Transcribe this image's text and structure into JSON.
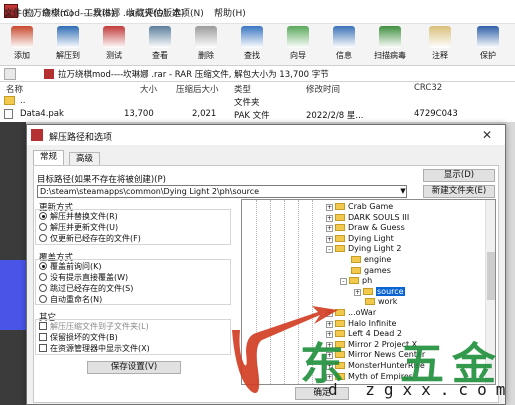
{
  "window": {
    "title": "拉万绕棋mod----坎琳娜 .rar (评估版本)"
  },
  "menu": [
    "文件(F)",
    "命令(C)",
    "工具(S)",
    "收藏夹(O)",
    "选项(N)",
    "帮助(H)"
  ],
  "toolbar": [
    {
      "label": "添加",
      "icon": "add-books-icon",
      "color": "#c84a2e"
    },
    {
      "label": "解压到",
      "icon": "extract-to-icon",
      "color": "#2f6db5"
    },
    {
      "label": "测试",
      "icon": "test-icon",
      "color": "#c23a3a"
    },
    {
      "label": "查看",
      "icon": "view-icon",
      "color": "#5c7f9c"
    },
    {
      "label": "删除",
      "icon": "delete-icon",
      "color": "#9b9b9b"
    },
    {
      "label": "查找",
      "icon": "find-icon",
      "color": "#3a76c2"
    },
    {
      "label": "向导",
      "icon": "wizard-icon",
      "color": "#59a85a"
    },
    {
      "label": "信息",
      "icon": "info-icon",
      "color": "#3a72b8"
    },
    {
      "label": "扫描病毒",
      "icon": "scan-virus-icon",
      "color": "#3f8f3f"
    },
    {
      "label": "注释",
      "icon": "comment-icon",
      "color": "#d9c07a"
    },
    {
      "label": "保护",
      "icon": "protect-icon",
      "color": "#2e5fa8"
    }
  ],
  "pathbar": {
    "text": "拉万绕棋mod----坎琳娜 .rar - RAR 压缩文件, 解包大小为 13,700 字节"
  },
  "filelist": {
    "columns": [
      "名称",
      "大小",
      "压缩后大小",
      "类型",
      "修改时间",
      "CRC32"
    ],
    "rows": [
      {
        "name": "..",
        "size": "",
        "packed": "",
        "type": "文件夹",
        "modified": "",
        "crc": ""
      },
      {
        "name": "Data4.pak",
        "size": "13,700",
        "packed": "2,021",
        "type": "PAK 文件",
        "modified": "2022/2/8 星...",
        "crc": "4729C043"
      }
    ]
  },
  "dialog": {
    "title": "解压路径和选项",
    "tabs": [
      "常规",
      "高级"
    ],
    "dest_label": "目标路径(如果不存在将被创建)(P)",
    "dest_value": "D:\\steam\\steamapps\\common\\Dying Light 2\\ph\\source",
    "show_button": "显示(D)",
    "new_folder_button": "新建文件夹(E)",
    "update_title": "更新方式",
    "update_options": [
      "解压并替换文件(R)",
      "解压并更新文件(U)",
      "仅更新已经存在的文件(F)"
    ],
    "overwrite_title": "覆盖方式",
    "overwrite_options": [
      "覆盖前询问(K)",
      "没有提示直接覆盖(W)",
      "跳过已经存在的文件(S)",
      "自动重命名(N)"
    ],
    "misc_title": "其它",
    "misc_options": [
      "解压压缩文件到子文件夹(L)",
      "保留损坏的文件(B)",
      "在资源管理器中显示文件(X)"
    ],
    "save_button": "保存设置(V)",
    "ok_button": "确定",
    "tree_items": [
      {
        "label": "Crab Game",
        "level": 0,
        "expander": "+"
      },
      {
        "label": "DARK SOULS III",
        "level": 0,
        "expander": "+"
      },
      {
        "label": "Draw & Guess",
        "level": 0,
        "expander": "+"
      },
      {
        "label": "Dying Light",
        "level": 0,
        "expander": "+"
      },
      {
        "label": "Dying Light 2",
        "level": 0,
        "expander": "-"
      },
      {
        "label": "engine",
        "level": 1,
        "expander": ""
      },
      {
        "label": "games",
        "level": 1,
        "expander": ""
      },
      {
        "label": "ph",
        "level": 1,
        "expander": "-"
      },
      {
        "label": "source",
        "level": 2,
        "expander": "+",
        "selected": true
      },
      {
        "label": "work",
        "level": 2,
        "expander": ""
      },
      {
        "label": "...oWar",
        "level": 0,
        "expander": "+"
      },
      {
        "label": "Halo Infinite",
        "level": 0,
        "expander": "+"
      },
      {
        "label": "Left 4 Dead 2",
        "level": 0,
        "expander": "+"
      },
      {
        "label": "Mirror 2 Project X",
        "level": 0,
        "expander": "+"
      },
      {
        "label": "Mirror News Center",
        "level": 0,
        "expander": "+"
      },
      {
        "label": "MonsterHunterRise",
        "level": 0,
        "expander": "+"
      },
      {
        "label": "Myth of Empires",
        "level": 0,
        "expander": "+"
      }
    ]
  },
  "watermark": {
    "chars": [
      "东",
      "五",
      "金"
    ],
    "url": "d  zgxx.com"
  }
}
